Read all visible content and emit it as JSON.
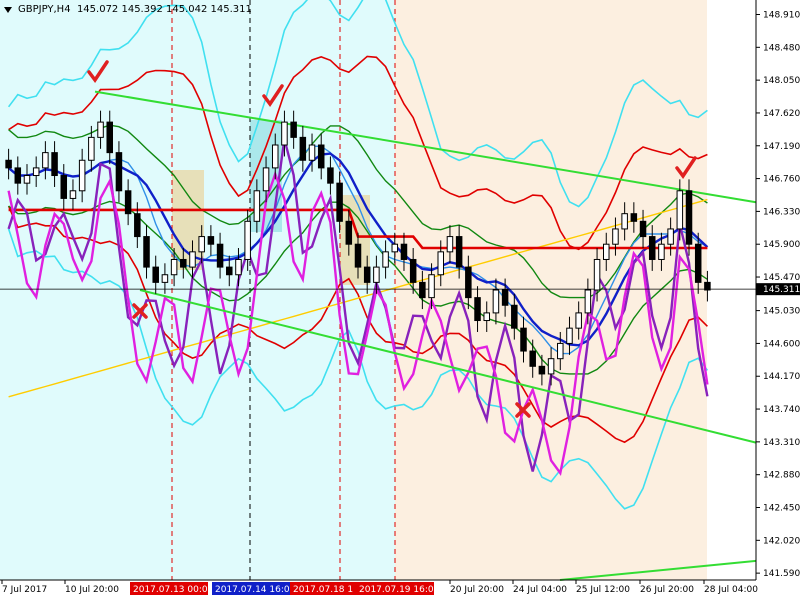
{
  "header": {
    "symbol": "GBPJPY,H4",
    "ohlc": "145.072 145.392 145.042 145.311"
  },
  "chart_data": {
    "type": "candlestick",
    "symbol": "GBPJPY",
    "timeframe": "H4",
    "ylim": [
      141.5,
      149.1
    ],
    "price_axis_ticks": [
      "148.910",
      "148.480",
      "148.050",
      "147.620",
      "147.190",
      "146.760",
      "146.330",
      "145.900",
      "145.470",
      "145.030",
      "144.600",
      "144.170",
      "143.740",
      "143.310",
      "142.880",
      "142.450",
      "142.020",
      "141.590"
    ],
    "current_price": "145.311",
    "time_labels": [
      "7 Jul 2017",
      "10 Jul 20:00",
      "20 Jul 20:00",
      "24 Jul 04:00",
      "25 Jul 12:00",
      "26 Jul 20:00",
      "28 Jul 04:00"
    ],
    "session_labels": [
      {
        "text": "2017.07.13 00:00",
        "color": "#e00000"
      },
      {
        "text": "2017.07.14 16:00",
        "color": "#1020c8"
      },
      {
        "text": "2017.07.18 1",
        "color": "#e00000"
      },
      {
        "text": "2017.07.19 16:00",
        "color": "#e00000"
      }
    ],
    "candles_close": [
      146.9,
      146.7,
      146.8,
      146.9,
      147.1,
      146.8,
      146.5,
      146.6,
      147.0,
      147.3,
      147.5,
      147.1,
      146.6,
      146.3,
      146.0,
      145.6,
      145.4,
      145.5,
      145.7,
      145.6,
      145.8,
      146.0,
      145.9,
      145.6,
      145.5,
      145.7,
      146.2,
      146.6,
      146.9,
      147.2,
      147.5,
      147.3,
      147.0,
      147.2,
      146.9,
      146.7,
      146.2,
      145.9,
      145.6,
      145.4,
      145.6,
      145.8,
      145.9,
      145.7,
      145.4,
      145.2,
      145.5,
      145.8,
      146.0,
      145.6,
      145.2,
      144.9,
      145.0,
      145.3,
      145.1,
      144.8,
      144.5,
      144.3,
      144.2,
      144.4,
      144.6,
      144.8,
      145.0,
      145.3,
      145.7,
      145.9,
      146.1,
      146.3,
      146.2,
      146.0,
      145.7,
      145.9,
      146.1,
      146.6,
      145.9,
      145.4,
      145.3
    ],
    "colors": {
      "background": "#ffffff",
      "cyan_zone": "#e0fbfc",
      "peach_zone": "#fcefe0",
      "bullish_candle": "#ffffff",
      "bearish_candle": "#000000",
      "trend_line": "#33dd33",
      "band_outer": "#40e0f0",
      "band_red": "#e00000",
      "band_green": "#118811",
      "ma_blue": "#1020c8",
      "ma_light_blue": "#3090e8",
      "ma_yellow": "#ffcc00",
      "purple_line": "#8822bb",
      "magenta_line": "#e020e0",
      "marker_red": "#e02020"
    }
  }
}
